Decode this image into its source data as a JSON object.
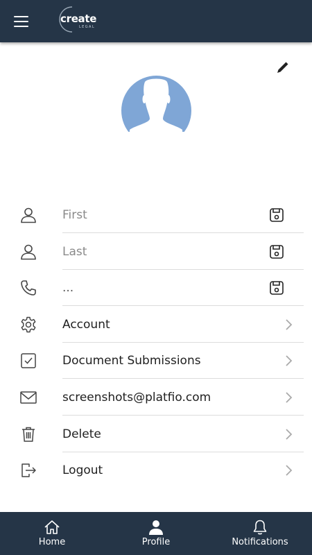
{
  "header": {
    "logo_text": "create",
    "logo_sub": "LEGAL",
    "menu_icon": "hamburger-menu-icon"
  },
  "profile": {
    "edit_icon": "pencil-icon",
    "avatar_color": "#7fa6d6"
  },
  "fields": [
    {
      "icon": "person-icon",
      "placeholder": "First",
      "value": "",
      "action_icon": "save-icon"
    },
    {
      "icon": "person-icon",
      "placeholder": "Last",
      "value": "",
      "action_icon": "save-icon"
    },
    {
      "icon": "phone-icon",
      "placeholder": "...",
      "value": "",
      "action_icon": "save-icon"
    }
  ],
  "menu": [
    {
      "icon": "gear-icon",
      "label": "Account"
    },
    {
      "icon": "checkbox-icon",
      "label": "Document Submissions"
    },
    {
      "icon": "envelope-icon",
      "label": "screenshots@platfio.com"
    },
    {
      "icon": "trash-icon",
      "label": "Delete"
    },
    {
      "icon": "logout-icon",
      "label": "Logout"
    }
  ],
  "bottom_nav": [
    {
      "icon": "home-icon",
      "label": "Home"
    },
    {
      "icon": "profile-icon",
      "label": "Profile"
    },
    {
      "icon": "bell-icon",
      "label": "Notifications"
    }
  ],
  "colors": {
    "bar": "#253547",
    "avatar": "#7fa6d6",
    "divider": "#dcdcdc"
  }
}
